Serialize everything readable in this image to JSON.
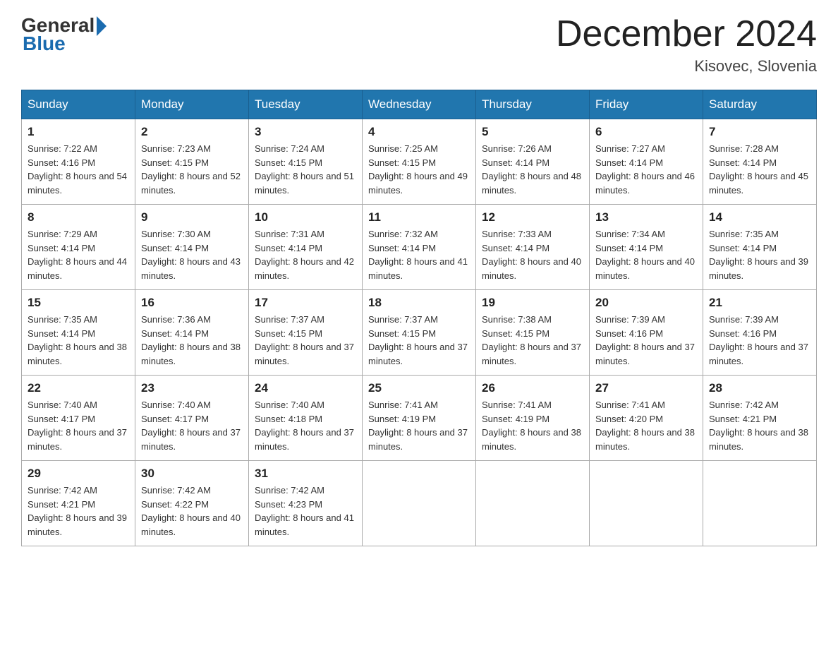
{
  "header": {
    "logo_general": "General",
    "logo_blue": "Blue",
    "month_title": "December 2024",
    "location": "Kisovec, Slovenia"
  },
  "weekdays": [
    "Sunday",
    "Monday",
    "Tuesday",
    "Wednesday",
    "Thursday",
    "Friday",
    "Saturday"
  ],
  "weeks": [
    [
      {
        "day": "1",
        "sunrise": "Sunrise: 7:22 AM",
        "sunset": "Sunset: 4:16 PM",
        "daylight": "Daylight: 8 hours and 54 minutes."
      },
      {
        "day": "2",
        "sunrise": "Sunrise: 7:23 AM",
        "sunset": "Sunset: 4:15 PM",
        "daylight": "Daylight: 8 hours and 52 minutes."
      },
      {
        "day": "3",
        "sunrise": "Sunrise: 7:24 AM",
        "sunset": "Sunset: 4:15 PM",
        "daylight": "Daylight: 8 hours and 51 minutes."
      },
      {
        "day": "4",
        "sunrise": "Sunrise: 7:25 AM",
        "sunset": "Sunset: 4:15 PM",
        "daylight": "Daylight: 8 hours and 49 minutes."
      },
      {
        "day": "5",
        "sunrise": "Sunrise: 7:26 AM",
        "sunset": "Sunset: 4:14 PM",
        "daylight": "Daylight: 8 hours and 48 minutes."
      },
      {
        "day": "6",
        "sunrise": "Sunrise: 7:27 AM",
        "sunset": "Sunset: 4:14 PM",
        "daylight": "Daylight: 8 hours and 46 minutes."
      },
      {
        "day": "7",
        "sunrise": "Sunrise: 7:28 AM",
        "sunset": "Sunset: 4:14 PM",
        "daylight": "Daylight: 8 hours and 45 minutes."
      }
    ],
    [
      {
        "day": "8",
        "sunrise": "Sunrise: 7:29 AM",
        "sunset": "Sunset: 4:14 PM",
        "daylight": "Daylight: 8 hours and 44 minutes."
      },
      {
        "day": "9",
        "sunrise": "Sunrise: 7:30 AM",
        "sunset": "Sunset: 4:14 PM",
        "daylight": "Daylight: 8 hours and 43 minutes."
      },
      {
        "day": "10",
        "sunrise": "Sunrise: 7:31 AM",
        "sunset": "Sunset: 4:14 PM",
        "daylight": "Daylight: 8 hours and 42 minutes."
      },
      {
        "day": "11",
        "sunrise": "Sunrise: 7:32 AM",
        "sunset": "Sunset: 4:14 PM",
        "daylight": "Daylight: 8 hours and 41 minutes."
      },
      {
        "day": "12",
        "sunrise": "Sunrise: 7:33 AM",
        "sunset": "Sunset: 4:14 PM",
        "daylight": "Daylight: 8 hours and 40 minutes."
      },
      {
        "day": "13",
        "sunrise": "Sunrise: 7:34 AM",
        "sunset": "Sunset: 4:14 PM",
        "daylight": "Daylight: 8 hours and 40 minutes."
      },
      {
        "day": "14",
        "sunrise": "Sunrise: 7:35 AM",
        "sunset": "Sunset: 4:14 PM",
        "daylight": "Daylight: 8 hours and 39 minutes."
      }
    ],
    [
      {
        "day": "15",
        "sunrise": "Sunrise: 7:35 AM",
        "sunset": "Sunset: 4:14 PM",
        "daylight": "Daylight: 8 hours and 38 minutes."
      },
      {
        "day": "16",
        "sunrise": "Sunrise: 7:36 AM",
        "sunset": "Sunset: 4:14 PM",
        "daylight": "Daylight: 8 hours and 38 minutes."
      },
      {
        "day": "17",
        "sunrise": "Sunrise: 7:37 AM",
        "sunset": "Sunset: 4:15 PM",
        "daylight": "Daylight: 8 hours and 37 minutes."
      },
      {
        "day": "18",
        "sunrise": "Sunrise: 7:37 AM",
        "sunset": "Sunset: 4:15 PM",
        "daylight": "Daylight: 8 hours and 37 minutes."
      },
      {
        "day": "19",
        "sunrise": "Sunrise: 7:38 AM",
        "sunset": "Sunset: 4:15 PM",
        "daylight": "Daylight: 8 hours and 37 minutes."
      },
      {
        "day": "20",
        "sunrise": "Sunrise: 7:39 AM",
        "sunset": "Sunset: 4:16 PM",
        "daylight": "Daylight: 8 hours and 37 minutes."
      },
      {
        "day": "21",
        "sunrise": "Sunrise: 7:39 AM",
        "sunset": "Sunset: 4:16 PM",
        "daylight": "Daylight: 8 hours and 37 minutes."
      }
    ],
    [
      {
        "day": "22",
        "sunrise": "Sunrise: 7:40 AM",
        "sunset": "Sunset: 4:17 PM",
        "daylight": "Daylight: 8 hours and 37 minutes."
      },
      {
        "day": "23",
        "sunrise": "Sunrise: 7:40 AM",
        "sunset": "Sunset: 4:17 PM",
        "daylight": "Daylight: 8 hours and 37 minutes."
      },
      {
        "day": "24",
        "sunrise": "Sunrise: 7:40 AM",
        "sunset": "Sunset: 4:18 PM",
        "daylight": "Daylight: 8 hours and 37 minutes."
      },
      {
        "day": "25",
        "sunrise": "Sunrise: 7:41 AM",
        "sunset": "Sunset: 4:19 PM",
        "daylight": "Daylight: 8 hours and 37 minutes."
      },
      {
        "day": "26",
        "sunrise": "Sunrise: 7:41 AM",
        "sunset": "Sunset: 4:19 PM",
        "daylight": "Daylight: 8 hours and 38 minutes."
      },
      {
        "day": "27",
        "sunrise": "Sunrise: 7:41 AM",
        "sunset": "Sunset: 4:20 PM",
        "daylight": "Daylight: 8 hours and 38 minutes."
      },
      {
        "day": "28",
        "sunrise": "Sunrise: 7:42 AM",
        "sunset": "Sunset: 4:21 PM",
        "daylight": "Daylight: 8 hours and 38 minutes."
      }
    ],
    [
      {
        "day": "29",
        "sunrise": "Sunrise: 7:42 AM",
        "sunset": "Sunset: 4:21 PM",
        "daylight": "Daylight: 8 hours and 39 minutes."
      },
      {
        "day": "30",
        "sunrise": "Sunrise: 7:42 AM",
        "sunset": "Sunset: 4:22 PM",
        "daylight": "Daylight: 8 hours and 40 minutes."
      },
      {
        "day": "31",
        "sunrise": "Sunrise: 7:42 AM",
        "sunset": "Sunset: 4:23 PM",
        "daylight": "Daylight: 8 hours and 41 minutes."
      },
      null,
      null,
      null,
      null
    ]
  ]
}
